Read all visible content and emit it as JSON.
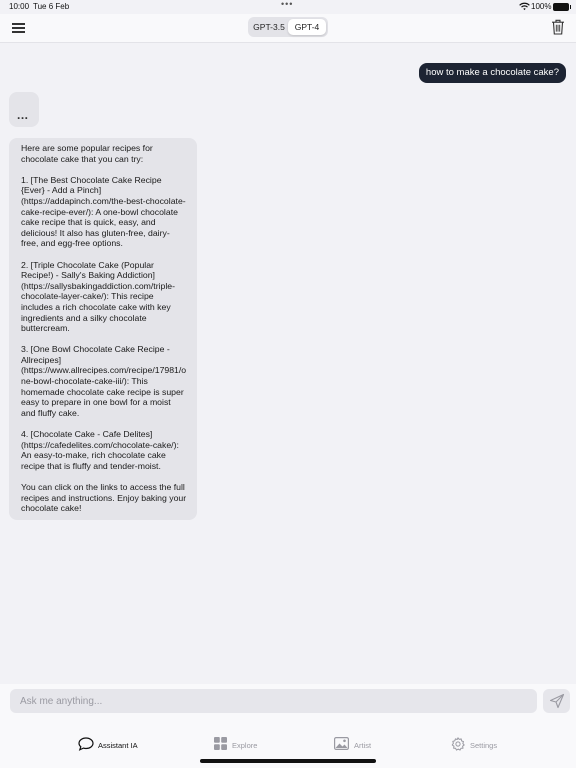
{
  "status": {
    "time": "10:00",
    "date": "Tue 6 Feb",
    "battery": "100%"
  },
  "header": {
    "model_options": [
      "GPT-3.5",
      "GPT-4"
    ],
    "selected_model": "GPT-4"
  },
  "chat": {
    "user_message": "how to make a chocolate cake?",
    "typing_indicator": "...",
    "assistant_paragraphs": [
      "Here are some popular recipes for chocolate cake that you can try:",
      "1. [The Best Chocolate Cake Recipe {Ever} - Add a Pinch](https://addapinch.com/the-best-chocolate-cake-recipe-ever/): A one-bowl chocolate cake recipe that is quick, easy, and delicious! It also has gluten-free, dairy-free, and egg-free options.",
      "2. [Triple Chocolate Cake (Popular Recipe!) - Sally's Baking Addiction](https://sallysbakingaddiction.com/triple-chocolate-layer-cake/): This recipe includes a rich chocolate cake with key ingredients and a silky chocolate buttercream.",
      "3. [One Bowl Chocolate Cake Recipe - Allrecipes](https://www.allrecipes.com/recipe/17981/one-bowl-chocolate-cake-iii/): This homemade chocolate cake recipe is super easy to prepare in one bowl for a moist and fluffy cake.",
      "4. [Chocolate Cake - Cafe Delites](https://cafedelites.com/chocolate-cake/): An easy-to-make, rich chocolate cake recipe that is fluffy and tender-moist.",
      "You can click on the links to access the full recipes and instructions. Enjoy baking your chocolate cake!"
    ]
  },
  "input": {
    "placeholder": "Ask me anything...",
    "value": ""
  },
  "tabs": [
    {
      "label": "Assistant IA",
      "icon": "chat-bubble-icon",
      "active": true
    },
    {
      "label": "Explore",
      "icon": "grid-icon",
      "active": false
    },
    {
      "label": "Artist",
      "icon": "image-icon",
      "active": false
    },
    {
      "label": "Settings",
      "icon": "gear-icon",
      "active": false
    }
  ],
  "colors": {
    "background": "#f2f2f6",
    "user_bubble": "#1d2433",
    "assistant_bubble": "#e4e4e9",
    "tab_active": "#111111",
    "tab_inactive": "#9a9aa2"
  }
}
